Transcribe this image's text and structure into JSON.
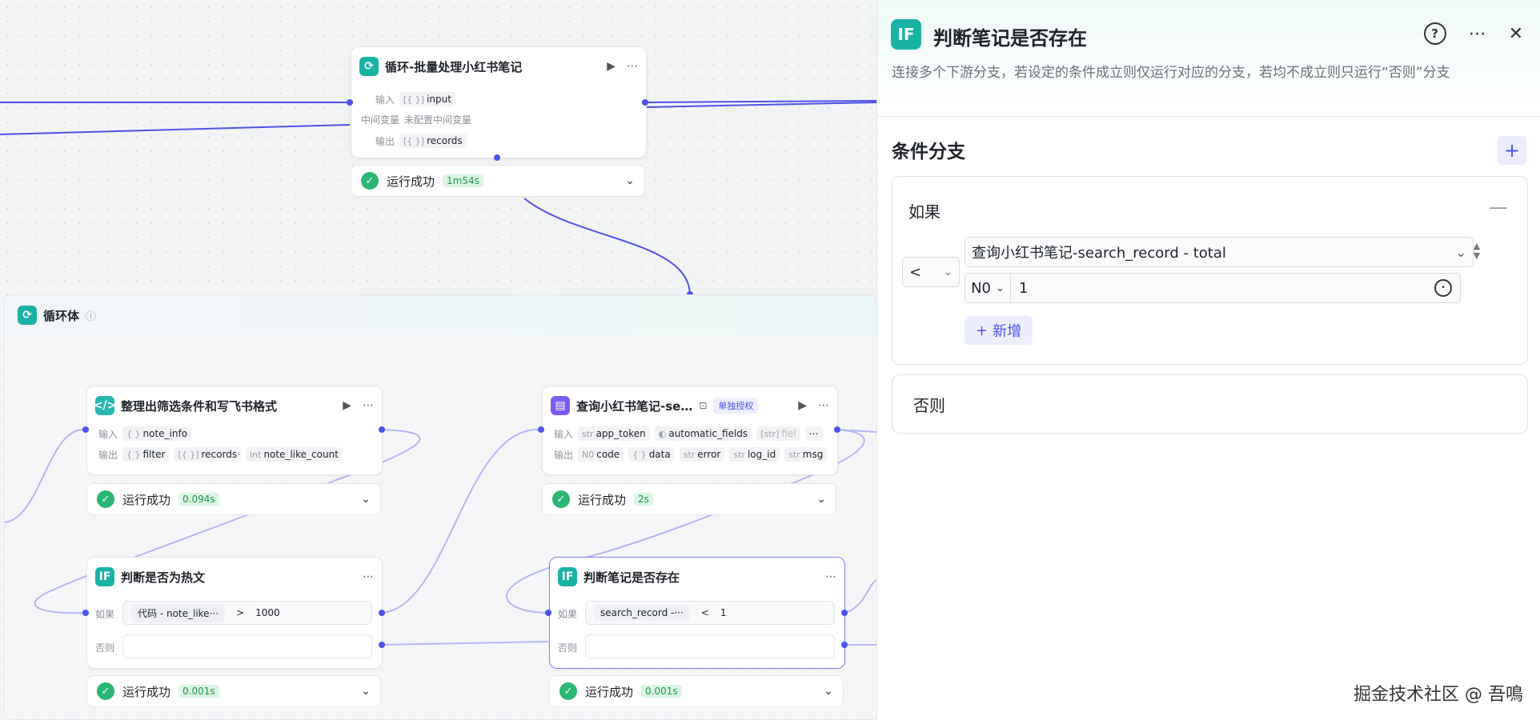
{
  "loop_node": {
    "title": "循环-批量处理小红书笔记",
    "input_label": "输入",
    "input_tag": "input",
    "mid_label": "中间变量",
    "mid_value": "未配置中间变量",
    "output_label": "输出",
    "output_tag": "records",
    "status": "运行成功",
    "time": "1m54s"
  },
  "group": {
    "title": "循环体"
  },
  "code_node": {
    "title": "整理出筛选条件和写飞书格式",
    "input_label": "输入",
    "in1_type": "{ }",
    "in1": "note_info",
    "output_label": "输出",
    "out1_type": "{ }",
    "out1": "filter",
    "out2_type": "[{ }]",
    "out2": "records",
    "out3_type": "int",
    "out3": "note_like_count",
    "status": "运行成功",
    "time": "0.094s"
  },
  "query_node": {
    "title": "查询小红书笔记-se…",
    "badge": "单独授权",
    "input_label": "输入",
    "in1_type": "str",
    "in1": "app_token",
    "in2": "automatic_fields",
    "in3_type": "[str]",
    "in3": "fiel",
    "output_label": "输出",
    "out1_type": "N0",
    "out1": "code",
    "out2_type": "{ }",
    "out2": "data",
    "out3_type": "str",
    "out3": "error",
    "out4_type": "str",
    "out4": "log_id",
    "out5_type": "str",
    "out5": "msg",
    "status": "运行成功",
    "time": "2s"
  },
  "hot_node": {
    "title": "判断是否为热文",
    "if_label": "如果",
    "else_label": "否则",
    "cond_left": "代码 - note_like···",
    "op": ">",
    "cond_right": "1000",
    "status": "运行成功",
    "time": "0.001s"
  },
  "exists_node": {
    "title": "判断笔记是否存在",
    "if_label": "如果",
    "else_label": "否则",
    "cond_left": "search_record -···",
    "op": "<",
    "cond_right": "1",
    "status": "运行成功",
    "time": "0.001s"
  },
  "panel": {
    "title": "判断笔记是否存在",
    "desc": "连接多个下游分支，若设定的条件成立则仅运行对应的分支，若均不成立则只运行“否则”分支",
    "section": "条件分支",
    "if_label": "如果",
    "operator": "<",
    "var_path": "查询小红书笔记-search_record - total",
    "value_type": "N0",
    "value": "1",
    "add_label": "新增",
    "else_label": "否则"
  },
  "watermark": "掘金技术社区 @ 吾鳴"
}
